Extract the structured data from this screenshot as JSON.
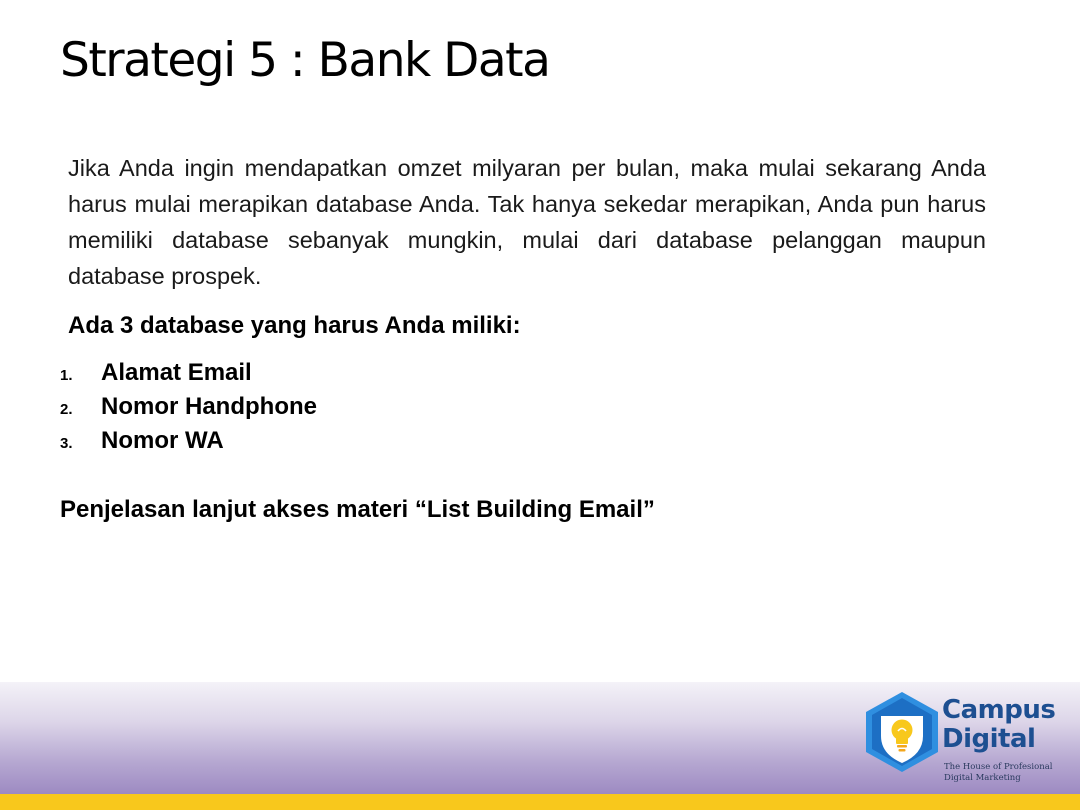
{
  "slide": {
    "title": "Strategi 5 : Bank Data",
    "intro": "Jika Anda ingin mendapatkan omzet milyaran per bulan, maka mulai sekarang Anda harus mulai merapikan database Anda. Tak hanya sekedar merapikan, Anda pun harus memiliki database sebanyak mungkin, mulai dari database pelanggan maupun database prospek.",
    "list_heading": "Ada 3 database yang harus Anda miliki:",
    "items": [
      {
        "number": "1.",
        "label": "Alamat Email"
      },
      {
        "number": "2.",
        "label": "Nomor Handphone"
      },
      {
        "number": "3.",
        "label": "Nomor WA"
      }
    ],
    "note": "Penjelasan lanjut akses materi “List Building Email”"
  },
  "brand": {
    "name_line1": "Campus",
    "name_line2": "Digital",
    "tagline_line1": "The House of Profesional",
    "tagline_line2": "Digital Marketing",
    "logo_icon": "lightbulb-shield-icon",
    "colors": {
      "primary_blue": "#1d4f91",
      "hexagon_blue": "#2f8fe0",
      "bulb_yellow": "#f8c81c",
      "footer_stripe": "#f8c81c",
      "footer_purple": "#9d8ac2"
    }
  }
}
